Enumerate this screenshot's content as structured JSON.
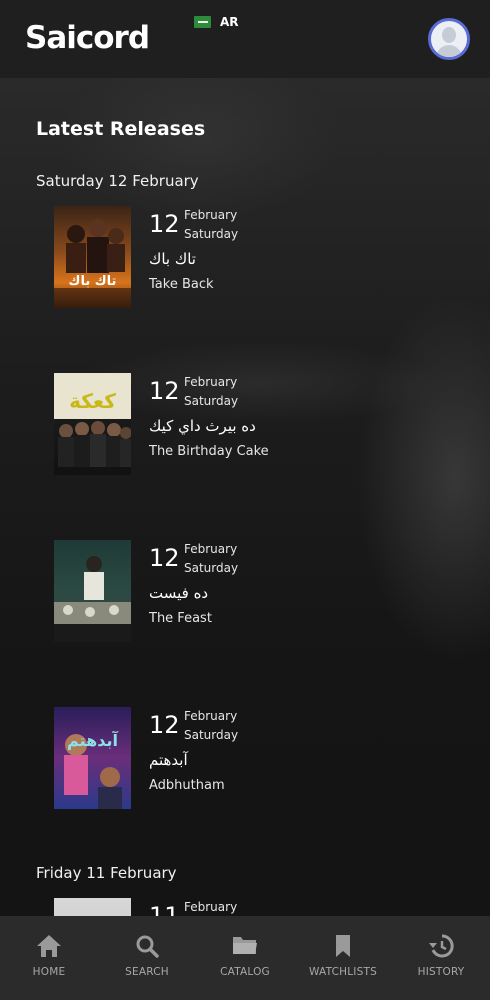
{
  "app": {
    "brand": "Saicord",
    "language_label": "AR",
    "flag_icon": "saudi-flag-icon"
  },
  "main": {
    "section_title": "Latest Releases",
    "groups": [
      {
        "day_label": "Saturday 12 February",
        "items": [
          {
            "day": "12",
            "month": "February",
            "weekday": "Saturday",
            "title_ar": "تاك باك",
            "title_en": "Take Back",
            "poster_text": "تاك باك"
          },
          {
            "day": "12",
            "month": "February",
            "weekday": "Saturday",
            "title_ar": "ده بيرث داي كيك",
            "title_en": "The Birthday Cake",
            "poster_text": "كعكة"
          },
          {
            "day": "12",
            "month": "February",
            "weekday": "Saturday",
            "title_ar": "ده فيست",
            "title_en": "The Feast",
            "poster_text": ""
          },
          {
            "day": "12",
            "month": "February",
            "weekday": "Saturday",
            "title_ar": "آبدهتم",
            "title_en": "Adbhutham",
            "poster_text": "آبدهتم"
          }
        ]
      },
      {
        "day_label": "Friday 11 February",
        "items": [
          {
            "day": "11",
            "month": "February",
            "weekday": "",
            "title_ar": "",
            "title_en": "",
            "poster_text": ""
          }
        ]
      }
    ]
  },
  "nav": [
    {
      "label": "HOME",
      "icon": "home-icon"
    },
    {
      "label": "SEARCH",
      "icon": "search-icon"
    },
    {
      "label": "CATALOG",
      "icon": "folder-icon"
    },
    {
      "label": "WATCHLISTS",
      "icon": "bookmark-icon"
    },
    {
      "label": "HISTORY",
      "icon": "history-icon"
    }
  ],
  "colors": {
    "nav_icon": "#9a9a9a",
    "avatar_ring": "#5b6bd6",
    "background": "#161616"
  }
}
